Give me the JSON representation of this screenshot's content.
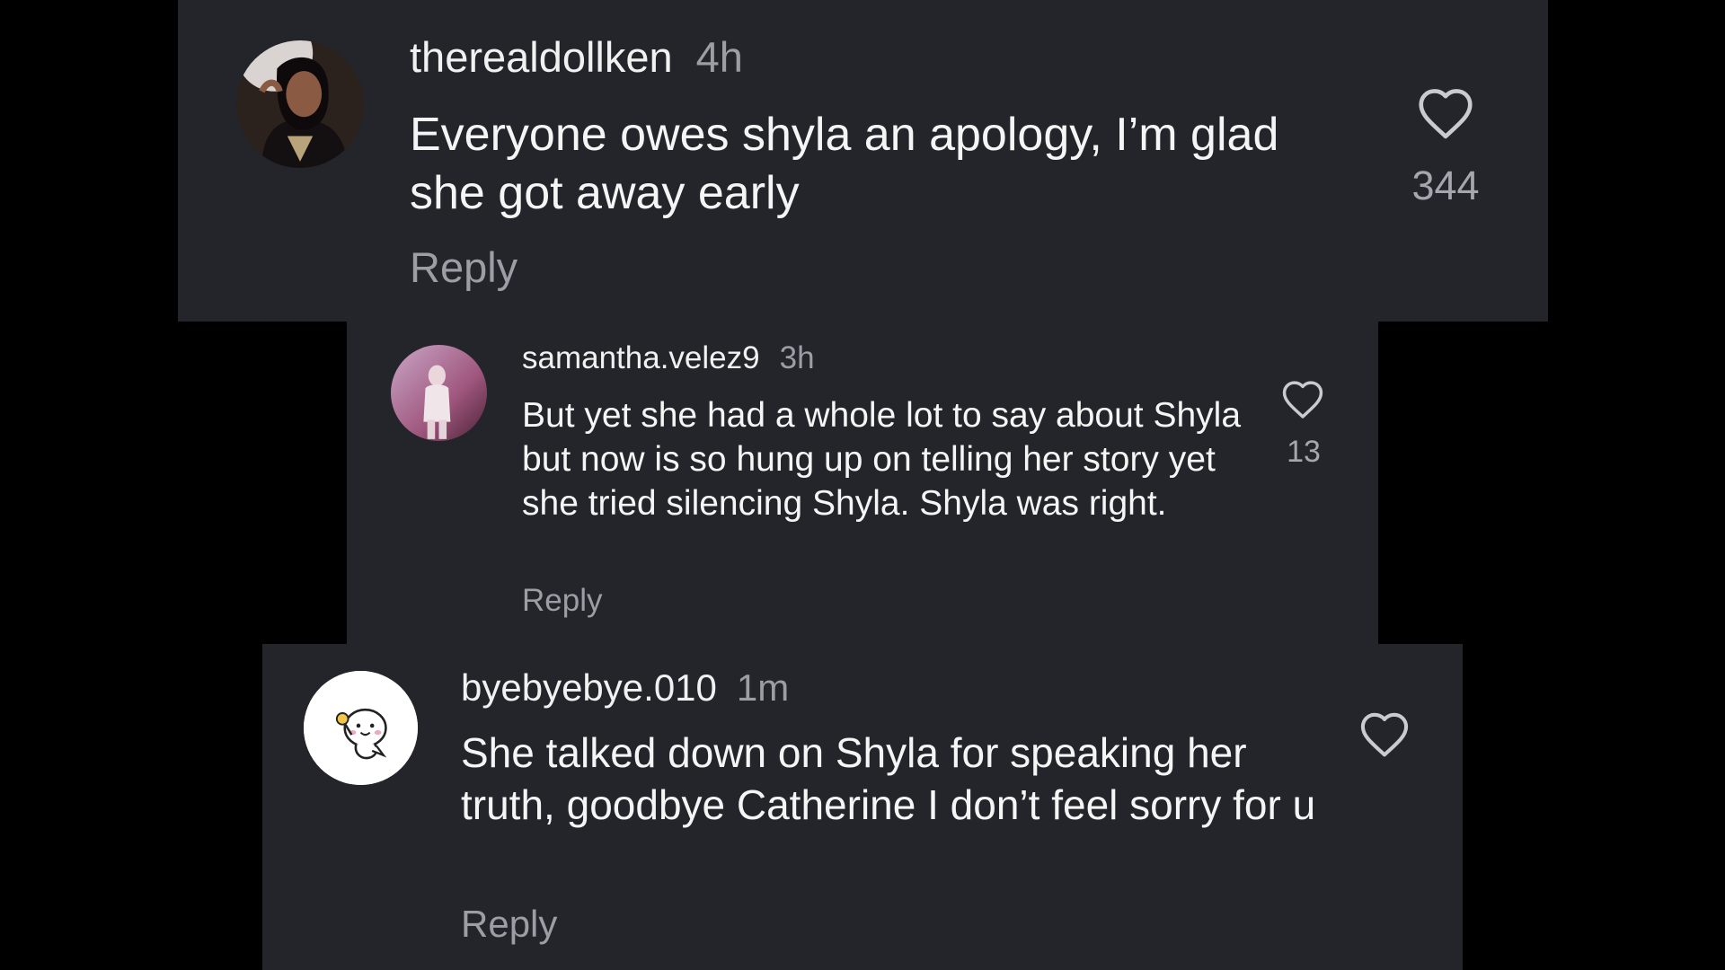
{
  "comments": [
    {
      "username": "therealdollken",
      "time": "4h",
      "text": "Everyone owes shyla an apology, I’m glad she got away early",
      "reply_label": "Reply",
      "likes": "344",
      "avatar_icon": "user-avatar-photo",
      "like_icon": "heart-outline-icon"
    },
    {
      "username": "samantha.velez9",
      "time": "3h",
      "text": "But yet she had a whole lot to say about Shyla but now is so hung up on telling her story yet she tried silencing Shyla. Shyla was right.",
      "reply_label": "Reply",
      "likes": "13",
      "avatar_icon": "user-avatar-photo",
      "like_icon": "heart-outline-icon"
    },
    {
      "username": "byebyebye.010",
      "time": "1m",
      "text": "She talked down on Shyla for speaking her truth, goodbye Catherine I don’t feel sorry for u",
      "reply_label": "Reply",
      "avatar_icon": "cartoon-avatar",
      "like_icon": "heart-outline-icon"
    }
  ],
  "colors": {
    "background": "#000000",
    "card": "#23252b",
    "text": "#f5f5f5",
    "muted": "#9b9ea4"
  }
}
